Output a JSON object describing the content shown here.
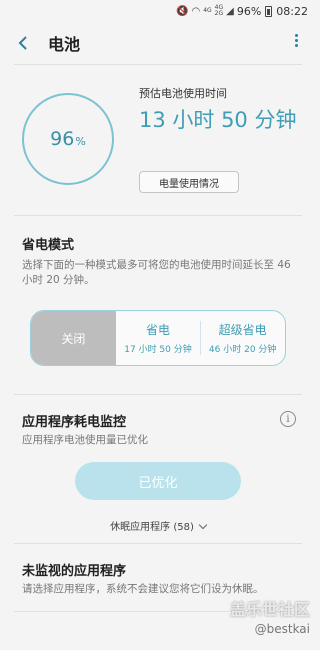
{
  "status": {
    "net1": "4G",
    "net2": "4G",
    "net3": "2G",
    "battery": "96%",
    "time": "08:22"
  },
  "appbar": {
    "title": "电池"
  },
  "battery": {
    "percent": "96",
    "percent_unit": "%",
    "est_label": "预估电池使用时间",
    "est_value": "13 小时 50 分钟",
    "usage_button": "电量使用情况"
  },
  "power_mode": {
    "title": "省电模式",
    "desc": "选择下面的一种模式最多可将您的电池使用时间延长至 46 小时 20 分钟。",
    "modes": [
      {
        "name": "关闭"
      },
      {
        "name": "省电",
        "sub": "17 小时 50 分钟"
      },
      {
        "name": "超级省电",
        "sub": "46 小时 20 分钟"
      }
    ]
  },
  "app_monitor": {
    "title": "应用程序耗电监控",
    "desc": "应用程序电池使用量已优化",
    "optimized_button": "已优化",
    "sleeping_apps": "休眠应用程序 (58)"
  },
  "unmonitored": {
    "title": "未监视的应用程序",
    "desc": "请选择应用程序，系统不会建议您将它们设为休眠。"
  },
  "watermark": {
    "line1": "盖乐世社区",
    "line2": "@bestkai"
  }
}
